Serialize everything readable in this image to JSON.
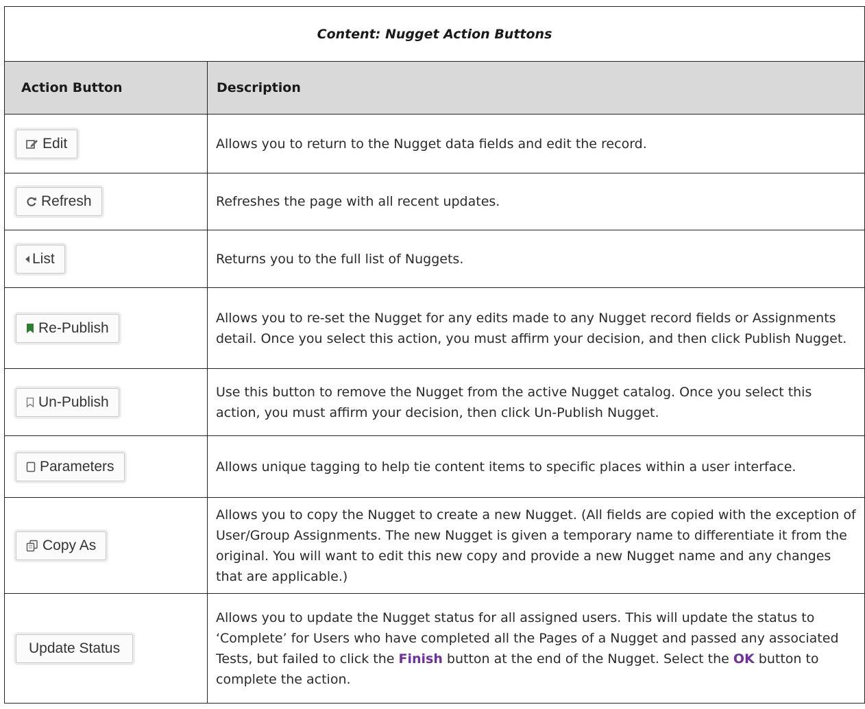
{
  "title": "Content: Nugget Action Buttons",
  "headers": {
    "col1": "Action Button",
    "col2": "Description"
  },
  "rows": [
    {
      "button": "Edit",
      "icon": "edit-icon",
      "description": "Allows you to return to the Nugget data fields and edit the record."
    },
    {
      "button": "Refresh",
      "icon": "refresh-icon",
      "description": "Refreshes the page with all recent updates."
    },
    {
      "button": "List",
      "icon": "caret-left-icon",
      "description": "Returns you to the full list of Nuggets."
    },
    {
      "button": "Re-Publish",
      "icon": "bookmark-filled-icon",
      "description": "Allows you to re-set the Nugget for any edits made to any Nugget record fields or Assignments detail. Once you select this action, you must affirm your decision, and then click Publish Nugget."
    },
    {
      "button": "Un-Publish",
      "icon": "bookmark-outline-icon",
      "description": "Use this button to remove the Nugget from the active Nugget catalog. Once you select this action, you must affirm your decision, then click Un-Publish Nugget."
    },
    {
      "button": "Parameters",
      "icon": "square-icon",
      "description": "Allows unique tagging to help tie content items to specific places within a user interface."
    },
    {
      "button": "Copy As",
      "icon": "copy-icon",
      "description": "Allows you to copy the Nugget to create a new Nugget. (All fields are copied with the exception of User/Group Assignments. The new Nugget is given a temporary name to differentiate it from the original. You will want to edit this new copy and provide a new Nugget name and any changes that are applicable.)"
    },
    {
      "button": "Update Status",
      "icon": "",
      "description_parts": {
        "p1": "Allows you to update the Nugget status for all assigned users.  This will update the status to ‘Complete’ for Users who have completed all the Pages of a Nugget and passed any associated Tests, but failed to click the ",
        "finish": "Finish",
        "p2": " button at the end of the Nugget.  Select the ",
        "ok": "OK",
        "p3": " button to complete the action."
      }
    }
  ],
  "colors": {
    "header_bg": "#d9d9d9",
    "highlight": "#7030a0",
    "border": "#222222"
  }
}
